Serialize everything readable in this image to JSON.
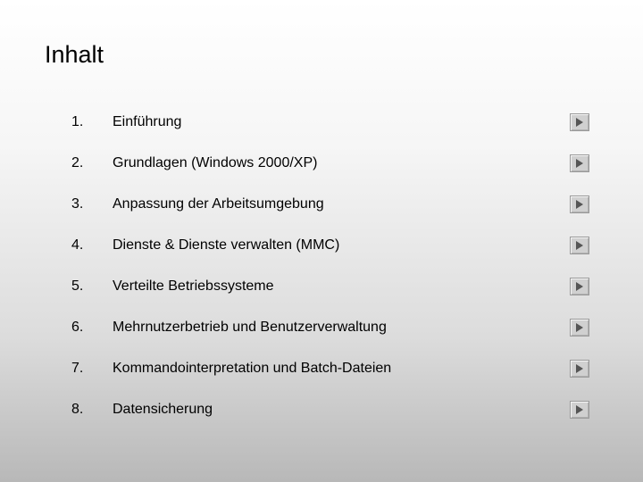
{
  "title": "Inhalt",
  "items": [
    {
      "num": "1.",
      "label": "Einführung"
    },
    {
      "num": "2.",
      "label": "Grundlagen (Windows 2000/XP)"
    },
    {
      "num": "3.",
      "label": "Anpassung der Arbeitsumgebung"
    },
    {
      "num": "4.",
      "label": "Dienste & Dienste verwalten (MMC)"
    },
    {
      "num": "5.",
      "label": "Verteilte Betriebssysteme"
    },
    {
      "num": "6.",
      "label": "Mehrnutzerbetrieb und Benutzerverwaltung"
    },
    {
      "num": "7.",
      "label": "Kommandointerpretation und Batch-Dateien"
    },
    {
      "num": "8.",
      "label": "Datensicherung"
    }
  ]
}
